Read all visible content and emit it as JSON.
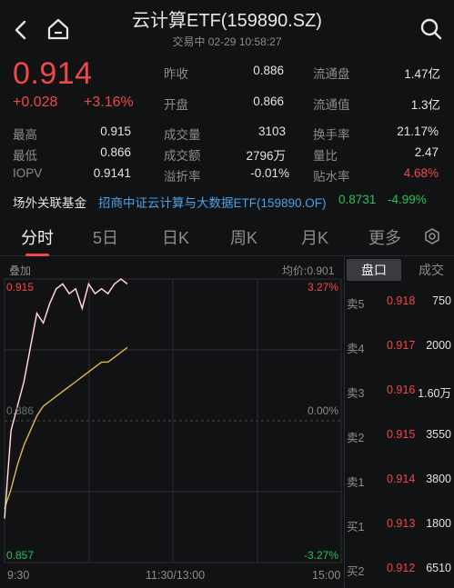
{
  "header": {
    "title": "云计算ETF(159890.SZ)",
    "subtitle": "交易中 02-29 10:58:27"
  },
  "quote": {
    "price": "0.914",
    "change": "+0.028",
    "change_pct": "+3.16%"
  },
  "stats_top": [
    {
      "label": "昨收",
      "value": "0.886"
    },
    {
      "label": "流通盘",
      "value": "1.47亿"
    },
    {
      "label": "开盘",
      "value": "0.866"
    },
    {
      "label": "流通值",
      "value": "1.3亿"
    }
  ],
  "stats_grid": [
    {
      "label": "最高",
      "value": "0.915"
    },
    {
      "label": "成交量",
      "value": "3103"
    },
    {
      "label": "换手率",
      "value": "21.17%"
    },
    {
      "label": "最低",
      "value": "0.866"
    },
    {
      "label": "成交额",
      "value": "2796万"
    },
    {
      "label": "量比",
      "value": "2.47"
    },
    {
      "label": "IOPV",
      "value": "0.9141"
    },
    {
      "label": "溢折率",
      "value": "-0.01%"
    },
    {
      "label": "贴水率",
      "value": "4.68%"
    }
  ],
  "fund": {
    "label": "场外关联基金",
    "name": "招商中证云计算与大数据ETF(159890.OF)",
    "value": "0.8731",
    "pct": "-4.99%"
  },
  "tabs": [
    "分时",
    "5日",
    "日K",
    "周K",
    "月K",
    "更多"
  ],
  "chart_header": {
    "left": "叠加",
    "right": "均价:0.901"
  },
  "chart_axis": {
    "top_price": "0.915",
    "top_pct": "3.27%",
    "mid_price": "0.886",
    "mid_pct": "0.00%",
    "bottom_price": "0.857",
    "bottom_pct": "-3.27%",
    "time_start": "9:30",
    "time_mid": "11:30/13:00",
    "time_end": "15:00"
  },
  "chart_data": {
    "type": "line",
    "ylim": [
      0.857,
      0.915
    ],
    "baseline": 0.886,
    "series": [
      {
        "values": [
          0.866,
          0.884,
          0.889,
          0.894,
          0.901,
          0.908,
          0.906,
          0.91,
          0.913,
          0.914,
          0.912,
          0.913,
          0.909,
          0.914,
          0.912,
          0.913,
          0.912,
          0.914,
          0.915,
          0.914
        ]
      },
      {
        "values": [
          0.868,
          0.872,
          0.877,
          0.881,
          0.884,
          0.887,
          0.889,
          0.89,
          0.891,
          0.892,
          0.893,
          0.894,
          0.895,
          0.896,
          0.897,
          0.898,
          0.898,
          0.899,
          0.9,
          0.901
        ]
      }
    ],
    "colors": {
      "price": "#f0f0f0",
      "avg": "#e2b84a"
    }
  },
  "order_book": {
    "tabs": [
      "盘口",
      "成交"
    ],
    "rows": [
      {
        "side": "卖5",
        "price": "0.918",
        "vol": "750"
      },
      {
        "side": "卖4",
        "price": "0.917",
        "vol": "2000"
      },
      {
        "side": "卖3",
        "price": "0.916",
        "vol": "1.60万"
      },
      {
        "side": "卖2",
        "price": "0.915",
        "vol": "3550"
      },
      {
        "side": "卖1",
        "price": "0.914",
        "vol": "3800"
      },
      {
        "side": "买1",
        "price": "0.913",
        "vol": "1800"
      },
      {
        "side": "买2",
        "price": "0.912",
        "vol": "6510"
      }
    ]
  }
}
